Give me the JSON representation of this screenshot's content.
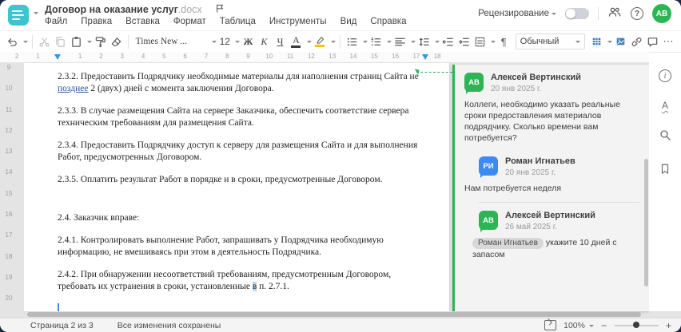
{
  "header": {
    "title": "Договор на оказание услуг",
    "title_ext": ".docx",
    "menu": [
      "Файл",
      "Правка",
      "Вставка",
      "Формат",
      "Таблица",
      "Инструменты",
      "Вид",
      "Справка"
    ],
    "review_label": "Рецензирование",
    "avatar_initials": "АВ"
  },
  "toolbar": {
    "font_name": "Times New ...",
    "font_size": "12",
    "bold_label": "Ж",
    "italic_label": "К",
    "underline_label": "Ч",
    "font_color_label": "А",
    "pilcrow": "¶",
    "more": "⋯",
    "style_name": "Обычный"
  },
  "ruler": {
    "margin_numbers": [
      "2",
      "1"
    ],
    "numbers": [
      "1",
      "2",
      "3",
      "4",
      "5",
      "6",
      "7",
      "8",
      "9",
      "10",
      "11",
      "12",
      "13",
      "14",
      "15",
      "16",
      "17",
      "18"
    ],
    "v_numbers": [
      "9",
      "10",
      "11",
      "12",
      "13",
      "14",
      "15",
      "16",
      "17",
      "18",
      "19",
      "20"
    ]
  },
  "document": {
    "p232_pre": "2.3.2. Предоставить Подрядчику необходимые материалы для наполнения страниц Сайта не ",
    "p232_ins": "позднее",
    "p232_post": " 2 (двух) дней с момента заключения Договора.",
    "p233": "2.3.3. В случае размещения Сайта на сервере Заказчика, обеспечить соответствие сервера техническим требованиям для размещения Сайта.",
    "p234": "2.3.4. Предоставить Подрядчику доступ к серверу для размещения Сайта и для выполнения Работ, предусмотренных Договором.",
    "p235": "2.3.5. Оплатить результат Работ в порядке и в сроки, предусмотренные Договором.",
    "p24": "2.4. Заказчик вправе:",
    "p241": "2.4.1. Контролировать выполнение Работ, запрашивать у Подрядчика необходимую информацию, не вмешиваясь при этом в деятельность Подрядчика.",
    "p242_pre": "2.4.2. При обнаружении несоответствий требованиям, предусмотренным Договором, требовать их устранения в сроки, установленные ",
    "p242_sel": "в",
    "p242_post": " п. 2.7.1."
  },
  "comments": {
    "entries": [
      {
        "initials": "АВ",
        "name": "Алексей Вертинский",
        "date": "20 янв 2025 г.",
        "text": "Коллеги, необходимо указать реальные сроки предоставления материалов подрядчику. Сколько времени вам потребуется?"
      },
      {
        "initials": "РИ",
        "name": "Роман Игнатьев",
        "date": "20 янв 2025 г.",
        "text": "Нам потребуется неделя"
      },
      {
        "initials": "АВ",
        "name": "Алексей Вертинский",
        "date": "26 май 2025 г.",
        "mention": "Роман Игнатьев",
        "text": "укажите 10 дней с запасом"
      }
    ]
  },
  "sidebar_icons": {
    "spell_letter": "А",
    "help_glyph": "?",
    "info_glyph": "i"
  },
  "statusbar": {
    "page_info": "Страница 2 из 3",
    "save_status": "Все изменения сохранены",
    "zoom_level": "100%",
    "minus": "−",
    "plus": "+"
  },
  "colors": {
    "app_teal": "#3bc5cf",
    "comment_green": "#2eb454",
    "reply_blue": "#3d8af5",
    "indent_marker_blue": "#2e9bd8",
    "selection_blue": "#b9d8f7"
  }
}
